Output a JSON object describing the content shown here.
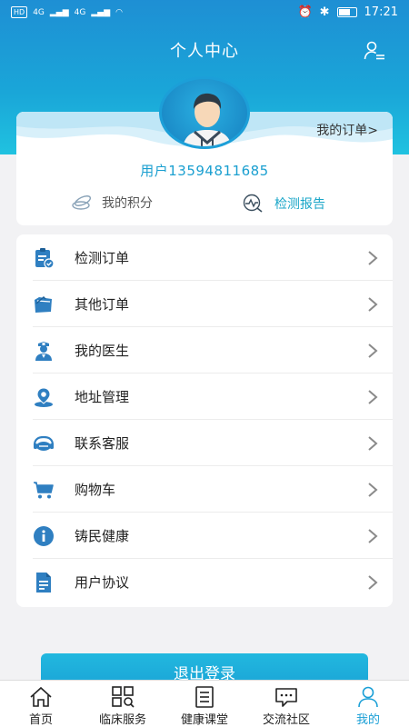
{
  "status_bar": {
    "left_badges": [
      "HD",
      "4G",
      "4G"
    ],
    "time": "17:21"
  },
  "header": {
    "title": "个人中心",
    "profile_icon": "user-list-icon"
  },
  "profile_card": {
    "my_orders_label": "我的订单>",
    "username": "用户13594811685",
    "points_label": "我的积分",
    "report_label": "检测报告"
  },
  "menu": {
    "items": [
      {
        "label": "检测订单",
        "icon": "clipboard-check-icon"
      },
      {
        "label": "其他订单",
        "icon": "folder-icon"
      },
      {
        "label": "我的医生",
        "icon": "doctor-icon"
      },
      {
        "label": "地址管理",
        "icon": "location-pin-icon"
      },
      {
        "label": "联系客服",
        "icon": "headset-icon"
      },
      {
        "label": "购物车",
        "icon": "cart-icon"
      },
      {
        "label": "铸民健康",
        "icon": "info-icon"
      },
      {
        "label": "用户协议",
        "icon": "document-icon"
      }
    ]
  },
  "logout_label": "退出登录",
  "tabbar": {
    "tabs": [
      {
        "label": "首页",
        "icon": "home-icon"
      },
      {
        "label": "临床服务",
        "icon": "grid-search-icon"
      },
      {
        "label": "健康课堂",
        "icon": "notebook-icon"
      },
      {
        "label": "交流社区",
        "icon": "chat-icon"
      },
      {
        "label": "我的",
        "icon": "person-icon"
      }
    ],
    "active_index": 4
  },
  "colors": {
    "primary": "#1a9fd6",
    "header_top": "#1e8fd4",
    "icon_blue": "#2f7fc1"
  }
}
